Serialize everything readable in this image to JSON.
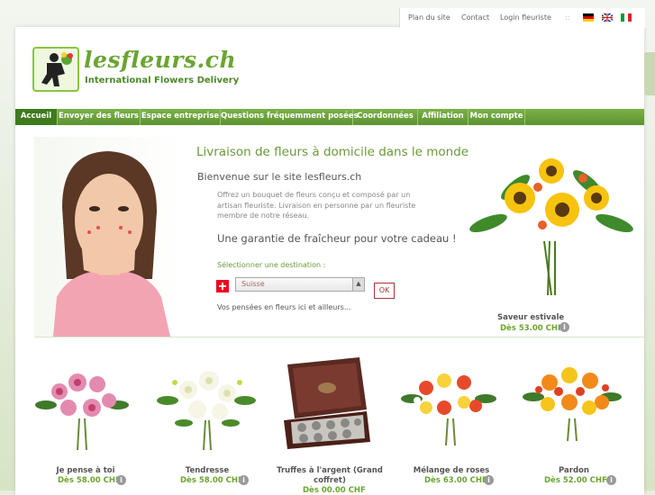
{
  "brand": {
    "title": "lesfleurs.ch",
    "subtitle": "International Flowers Delivery"
  },
  "toplinks": {
    "sitemap": "Plan du site",
    "contact": "Contact",
    "login": "Login fleuriste",
    "separator": "::"
  },
  "nav": {
    "items": [
      {
        "label": "Accueil"
      },
      {
        "label": "Envoyer des fleurs"
      },
      {
        "label": "Espace entreprise"
      },
      {
        "label": "Questions fréquemment posées"
      },
      {
        "label": "Coordonnées"
      },
      {
        "label": "Affiliation"
      },
      {
        "label": "Mon compte"
      }
    ]
  },
  "hero": {
    "heading": "Livraison de fleurs à domicile dans le monde",
    "welcome": "Bienvenue sur le site lesfleurs.ch",
    "description": "Offrez un bouquet de fleurs conçu et composé par un artisan fleuriste. Livraison en personne par un fleuriste membre de notre réseau.",
    "guarantee": "Une garantie de fraîcheur pour votre cadeau !",
    "select_label": "Sélectionner une destination :",
    "destination": "Suisse",
    "ok_label": "OK",
    "thoughts": "Vos pensées en fleurs ici et ailleurs..."
  },
  "featured": {
    "name": "Saveur estivale",
    "price": "Dès 53.00 CHF"
  },
  "products": [
    {
      "name": "Je pense à toi",
      "price": "Dès 58.00 CHF"
    },
    {
      "name": "Tendresse",
      "price": "Dès 58.00 CHF"
    },
    {
      "name": "Truffes à l'argent (Grand coffret)",
      "price": "Dès 00.00 CHF"
    },
    {
      "name": "Mélange de roses",
      "price": "Dès 63.00 CHF"
    },
    {
      "name": "Pardon",
      "price": "Dès 52.00 CHF"
    }
  ],
  "colors": {
    "brand_green": "#6aa531",
    "nav_active": "#3f7a1e",
    "swiss_red": "#e02"
  }
}
